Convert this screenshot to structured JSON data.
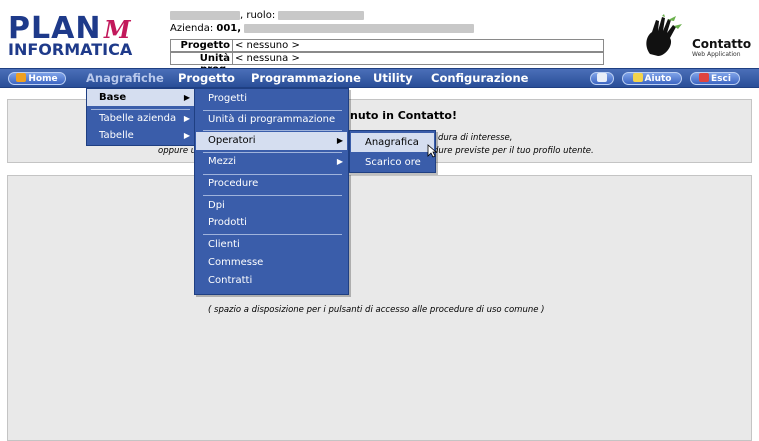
{
  "header": {
    "logo_line1": "PLAN",
    "logo_line2": "INFORMATICA",
    "logo_mark": "M",
    "user_suffix": ", ruolo:",
    "azienda_label": "Azienda:",
    "azienda_value": "001,",
    "progetto_label": "Progetto",
    "progetto_value": "< nessuno >",
    "unita_label": "Unità prog.",
    "unita_value": "< nessuna >",
    "brand_name": "Contatto",
    "brand_sub": "Web Application"
  },
  "nav": {
    "home": "Home",
    "anagrafiche": "Anagrafiche",
    "progetto": "Progetto",
    "programmazione": "Programmazione",
    "utility": "Utility",
    "configurazione": "Configurazione",
    "aiuto": "Aiuto",
    "esci": "Esci"
  },
  "main": {
    "welcome": "nuto in Contatto!",
    "msg1": "dura di interesse,",
    "msg2": "oppure u",
    "msg3": "dure previste per il tuo profilo utente.",
    "spazio": "( spazio a disposizione per i pulsanti di accesso alle procedure di uso comune )"
  },
  "menu_level1": {
    "items": [
      {
        "label": "Base"
      },
      {
        "label": "Tabelle azienda"
      },
      {
        "label": "Tabelle"
      }
    ]
  },
  "menu_level2": {
    "items": [
      {
        "label": "Progetti"
      },
      {
        "label": "Unità di programmazione"
      },
      {
        "label": "Operatori"
      },
      {
        "label": "Mezzi"
      },
      {
        "label": "Procedure"
      },
      {
        "label": "Dpi"
      },
      {
        "label": "Prodotti"
      },
      {
        "label": "Clienti"
      },
      {
        "label": "Commesse"
      },
      {
        "label": "Contratti"
      }
    ]
  },
  "menu_level3": {
    "items": [
      {
        "label": "Anagrafica"
      },
      {
        "label": "Scarico ore"
      }
    ]
  },
  "colors": {
    "nav_blue": "#294e98",
    "menu_blue": "#3a5daa",
    "menu_selected": "#d5def0",
    "logo_blue": "#1e3a8a",
    "logo_mark": "#c2185b",
    "panel_grey": "#e9e9e9"
  },
  "icons": {
    "home": "home-icon",
    "submenu": "chevron-right-icon",
    "aiuto": "help-icon",
    "esci": "exit-icon",
    "monitor": "monitor-icon",
    "brand": "hand-logo-icon",
    "cursor": "mouse-cursor-icon"
  }
}
